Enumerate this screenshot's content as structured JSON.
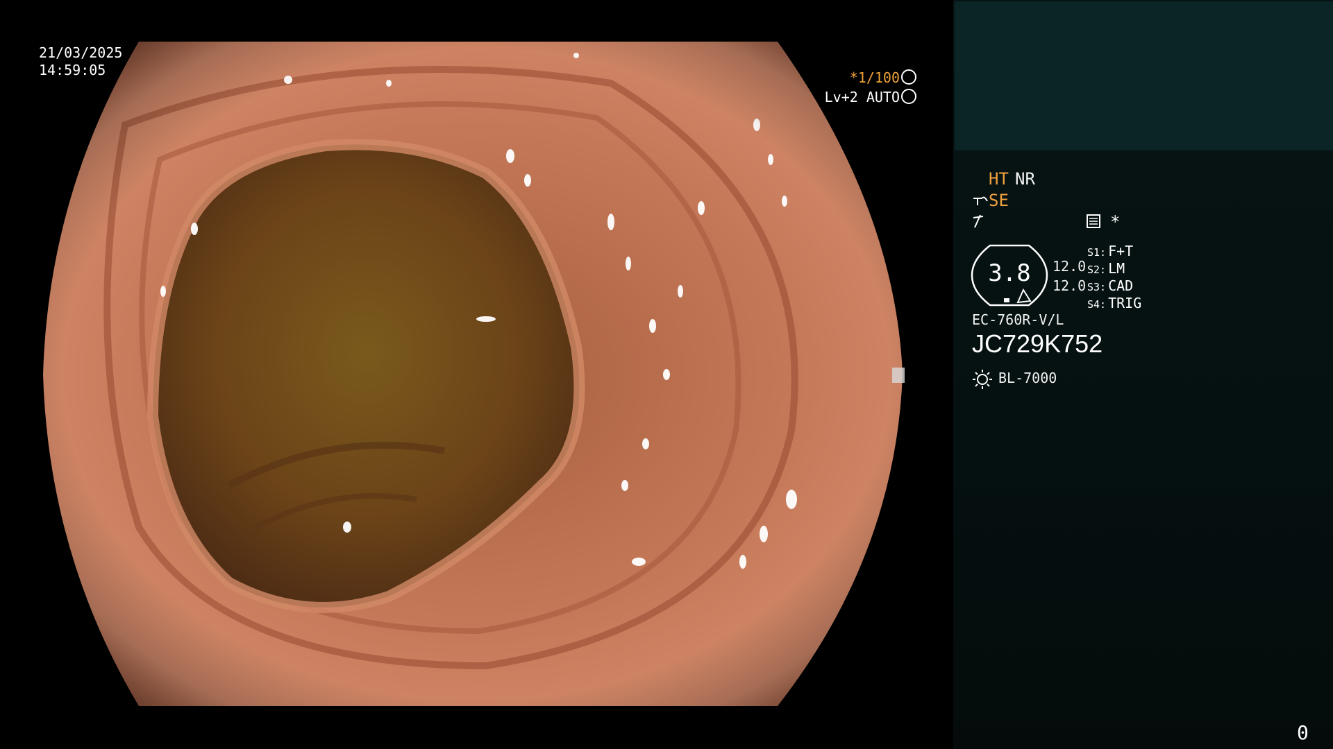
{
  "overlay": {
    "date": "21/03/2025",
    "time": "14:59:05",
    "shutter": "*1/100",
    "level": "Lv+2 AUTO"
  },
  "panel": {
    "ht": "HT",
    "nr": "NR",
    "se": "SE",
    "star": "*",
    "zoom": "3.8",
    "val1": "12.0",
    "val2": "12.0",
    "switches": [
      {
        "key": "S1:",
        "value": "F+T"
      },
      {
        "key": "S2:",
        "value": "LM"
      },
      {
        "key": "S3:",
        "value": "CAD"
      },
      {
        "key": "S4:",
        "value": "TRIG"
      }
    ],
    "scope_model": "EC-760R-V/L",
    "serial": "JC729K752",
    "light_source": "BL-7000",
    "corner_count": "0"
  },
  "colors": {
    "accent": "#f2a23e",
    "panel_top": "#0b2526",
    "tissue": "#c8785a"
  },
  "icons": [
    "shutter-icon",
    "iris-icon",
    "enhance-icon",
    "tilde-icon",
    "settings-icon",
    "sun-icon"
  ]
}
